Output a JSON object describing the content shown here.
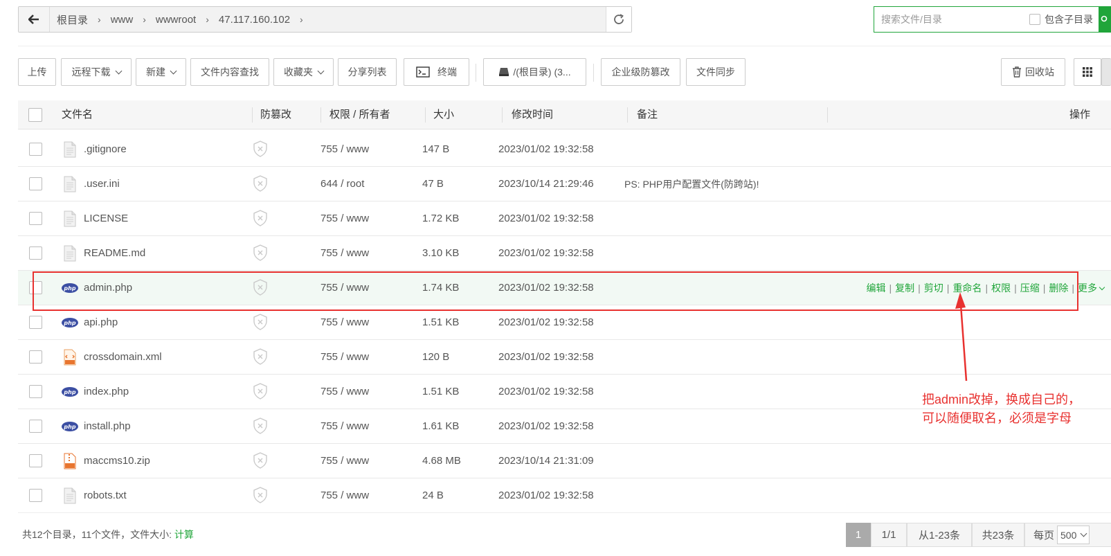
{
  "breadcrumb": [
    "根目录",
    "www",
    "wwwroot",
    "47.117.160.102"
  ],
  "search": {
    "placeholder": "搜索文件/目录",
    "include_sub_label": "包含子目录"
  },
  "toolbar": {
    "upload": "上传",
    "remote_download": "远程下载",
    "new": "新建",
    "content_search": "文件内容查找",
    "favorites": "收藏夹",
    "share_list": "分享列表",
    "terminal": "终端",
    "disk": "/(根目录) (3...",
    "tamper_proof": "企业级防篡改",
    "file_sync": "文件同步",
    "recycle_bin": "回收站"
  },
  "table": {
    "headers": [
      "文件名",
      "防篡改",
      "权限 / 所有者",
      "大小",
      "修改时间",
      "备注",
      "操作"
    ],
    "rows": [
      {
        "name": ".gitignore",
        "icon": "text-file-icon",
        "perm": "755 / www",
        "size": "147 B",
        "mtime": "2023/01/02 19:32:58",
        "note": ""
      },
      {
        "name": ".user.ini",
        "icon": "text-file-icon",
        "perm": "644 / root",
        "size": "47 B",
        "mtime": "2023/10/14 21:29:46",
        "note": "PS: PHP用户配置文件(防跨站)!"
      },
      {
        "name": "LICENSE",
        "icon": "text-file-icon",
        "perm": "755 / www",
        "size": "1.72 KB",
        "mtime": "2023/01/02 19:32:58",
        "note": ""
      },
      {
        "name": "README.md",
        "icon": "text-file-icon",
        "perm": "755 / www",
        "size": "3.10 KB",
        "mtime": "2023/01/02 19:32:58",
        "note": ""
      },
      {
        "name": "admin.php",
        "icon": "php-file-icon",
        "perm": "755 / www",
        "size": "1.74 KB",
        "mtime": "2023/01/02 19:32:58",
        "note": ""
      },
      {
        "name": "api.php",
        "icon": "php-file-icon",
        "perm": "755 / www",
        "size": "1.51 KB",
        "mtime": "2023/01/02 19:32:58",
        "note": ""
      },
      {
        "name": "crossdomain.xml",
        "icon": "xml-file-icon",
        "perm": "755 / www",
        "size": "120 B",
        "mtime": "2023/01/02 19:32:58",
        "note": ""
      },
      {
        "name": "index.php",
        "icon": "php-file-icon",
        "perm": "755 / www",
        "size": "1.51 KB",
        "mtime": "2023/01/02 19:32:58",
        "note": ""
      },
      {
        "name": "install.php",
        "icon": "php-file-icon",
        "perm": "755 / www",
        "size": "1.61 KB",
        "mtime": "2023/01/02 19:32:58",
        "note": ""
      },
      {
        "name": "maccms10.zip",
        "icon": "zip-file-icon",
        "perm": "755 / www",
        "size": "4.68 MB",
        "mtime": "2023/10/14 21:31:09",
        "note": ""
      },
      {
        "name": "robots.txt",
        "icon": "text-file-icon",
        "perm": "755 / www",
        "size": "24 B",
        "mtime": "2023/01/02 19:32:58",
        "note": ""
      }
    ],
    "row_actions": [
      "编辑",
      "复制",
      "剪切",
      "重命名",
      "权限",
      "压缩",
      "删除",
      "更多"
    ]
  },
  "annotation": {
    "line1": "把admin改掉，换成自己的，",
    "line2": "可以随便取名，必须是字母"
  },
  "footer": {
    "summary": "共12个目录，11个文件，文件大小: ",
    "calc": "计算",
    "page_current": "1",
    "page_total": "1/1",
    "range": "从1-23条",
    "total": "共23条",
    "per_page_label": "每页",
    "per_page_value": "500"
  },
  "colors": {
    "accent": "#20a53a",
    "annotation": "#e8312f",
    "php_icon": "#3c4fa3"
  }
}
